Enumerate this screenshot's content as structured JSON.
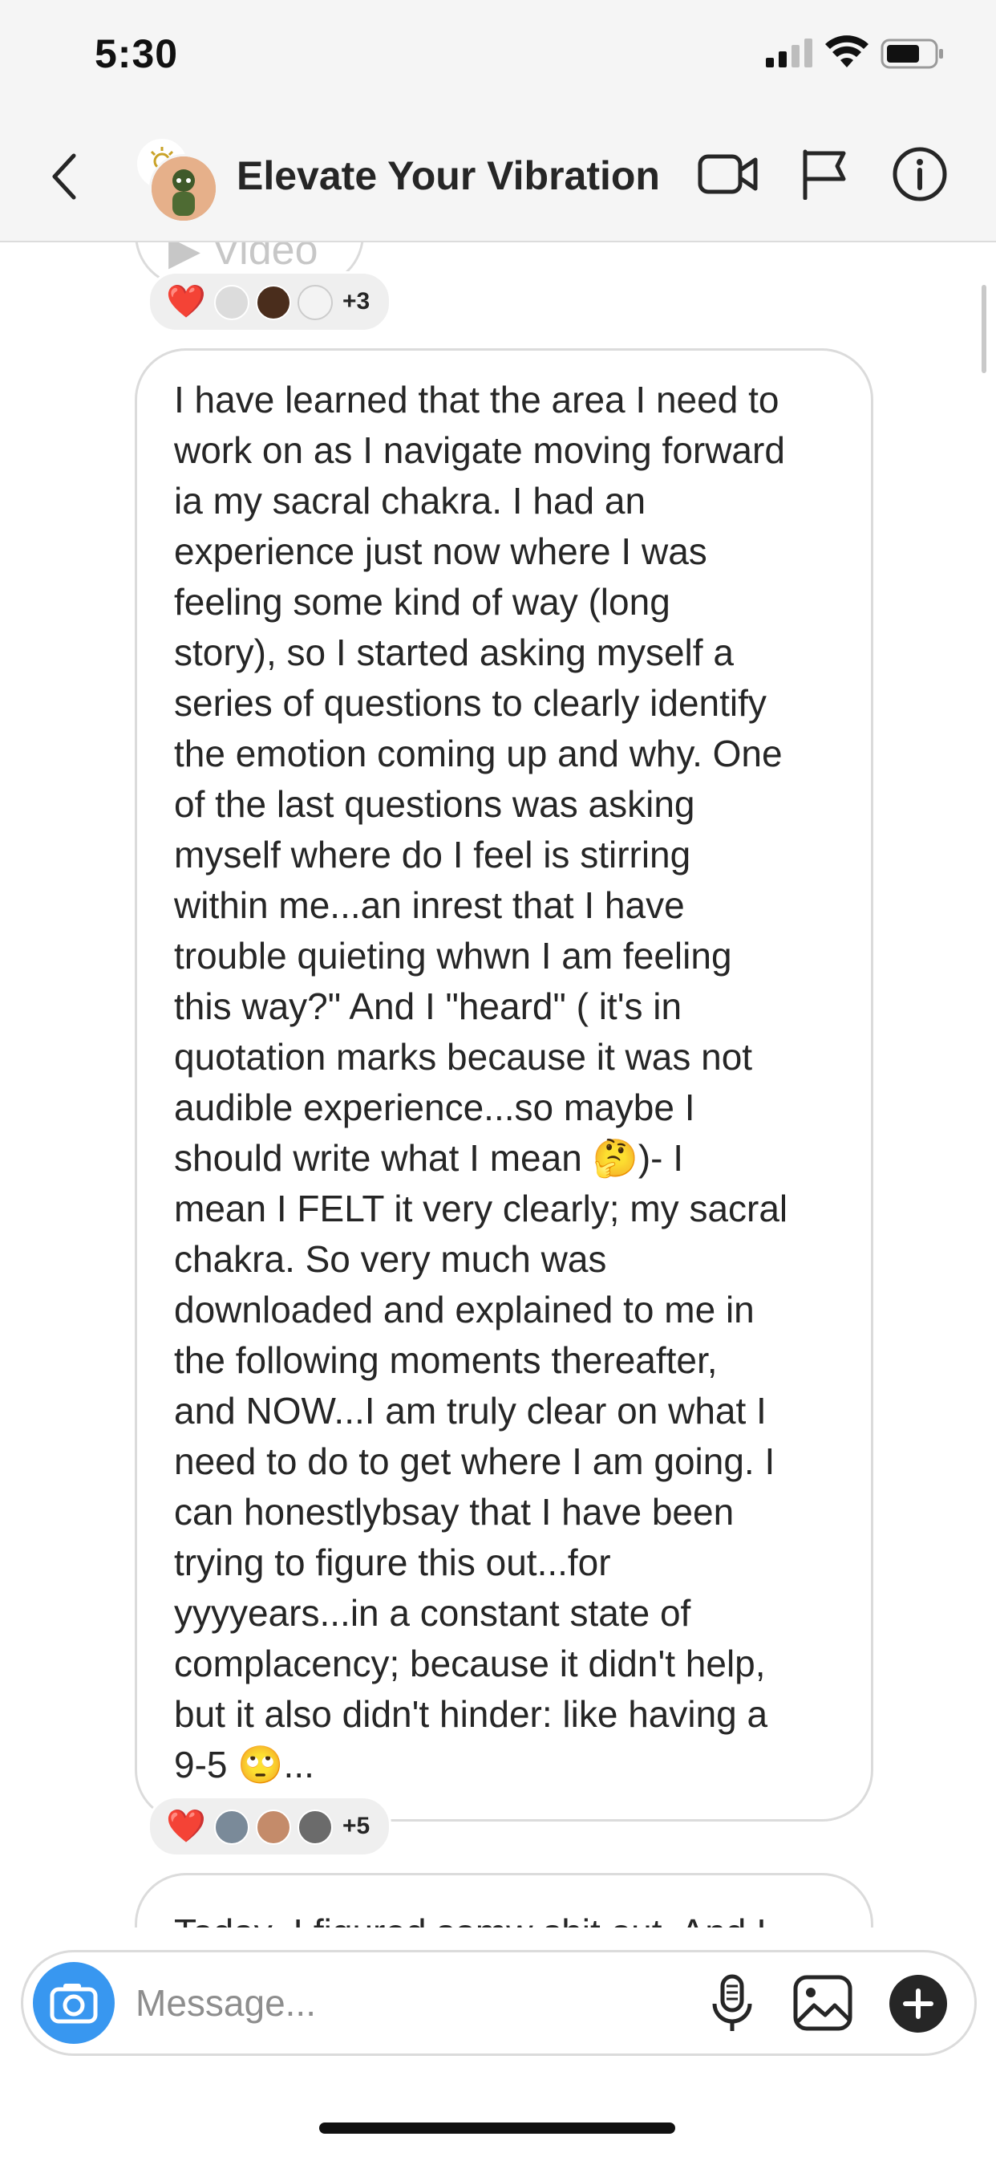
{
  "status_bar": {
    "time": "5:30"
  },
  "header": {
    "title": "Elevate Your Vibration",
    "icons": [
      "back-chevron-icon",
      "video-camera-icon",
      "flag-icon",
      "info-icon"
    ]
  },
  "thread": {
    "clipped_message_label": "Video",
    "reactions_top": {
      "emoji": "❤️",
      "count": "+3"
    },
    "message": {
      "text": "I have learned that the area I need to\nwork on as I navigate moving forward\nia my sacral chakra. I had an\nexperience just now where I was\nfeeling some kind of way (long\nstory), so I started asking myself a\nseries of questions to clearly identify\nthe emotion coming up and why. One\nof the last questions was asking\nmyself where do I feel is stirring\nwithin me...an inrest that I have\ntrouble quieting whwn I am feeling\nthis way?\" And I \"heard\" ( it's in\nquotation marks because it was not\naudible experience...so maybe I\nshould write what I mean 🤔)- I\nmean I FELT it very clearly; my sacral\nchakra. So very much was\ndownloaded and explained to me in\nthe following moments thereafter,\nand NOW...I am truly clear on what I\nneed to do to get where I am going. I\ncan honestlybsay that I have been\ntrying to figure this out...for\nyyyyears...in a constant state of\ncomplacency; because it didn't help,\nbut it also didn't hinder: like having a\n9-5 🙄..."
    },
    "reactions_bottom": {
      "emoji": "❤️",
      "count": "+5"
    },
    "next_message_preview": "Today  I figured somw shit out  And I"
  },
  "composer": {
    "placeholder": "Message...",
    "icons": [
      "camera-icon",
      "microphone-icon",
      "gallery-icon",
      "add-icon"
    ]
  },
  "colors": {
    "accent": "#3897f0",
    "heart": "#e0245e",
    "bubble_border": "#dbdbdb",
    "header_bg": "#f5f5f5"
  }
}
